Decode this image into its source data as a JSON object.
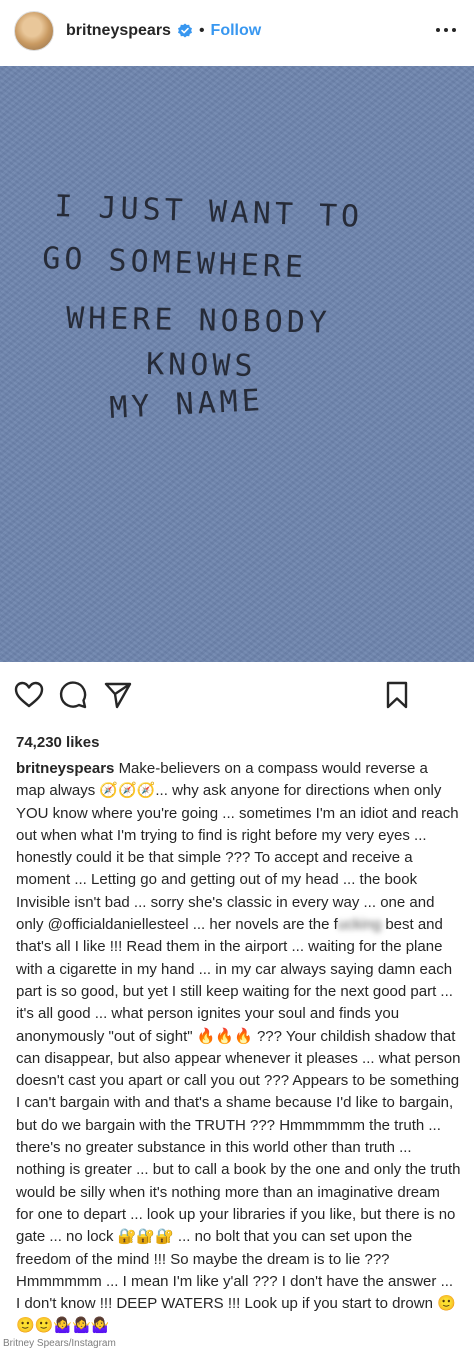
{
  "header": {
    "username": "britneyspears",
    "separator": "•",
    "follow_label": "Follow"
  },
  "photo": {
    "handwritten_lines": [
      "I JUST WANT TO",
      "GO SOMEWHERE",
      "WHERE NOBODY",
      "KNOWS",
      "MY NAME"
    ]
  },
  "likes": "74,230 likes",
  "caption": {
    "username": "britneyspears",
    "part1": "Make-believers on a compass would reverse a map always 🧭🧭🧭... why ask anyone for directions when only YOU know where you're going ... sometimes I'm an idiot and reach out when what I'm trying to find is right before my very eyes ... honestly could it be that simple ??? To accept and receive a moment ... Letting go and getting out of my head ... the book Invisible isn't bad ... sorry she's classic in every way ... one and only @officialdaniellesteel ... her novels are the f",
    "blurred": "ucking",
    "part2": " best and that's all I like !!! Read them in the airport ... waiting for the plane with a cigarette in my hand ... in my car always saying damn each part is so good, but yet I still keep waiting for the next good part ... it's all good ... what person ignites your soul and finds you anonymously \"out of sight\" 🔥🔥🔥 ??? Your childish shadow that can disappear, but also appear whenever it pleases ... what person doesn't cast you apart or call you out ??? Appears to be something I can't bargain with and that's a shame because I'd like to bargain, but do we bargain with the TRUTH ??? Hmmmmmm the truth ... there's no greater substance in this world other than truth ... nothing is greater ... but to call a book by the one and only the truth would be silly when it's nothing more than an imaginative dream for one to depart ... look up your libraries if you like, but there is no gate ... no lock 🔐🔐🔐 ... no bolt that you can set upon the freedom of the mind !!! So maybe the dream is to lie ??? Hmmmmmm ... I mean I'm like y'all ??? I don't have the answer ... I don't know !!! DEEP WATERS !!! Look up if you start to drown 🙂🙂🙂🤷‍♀️🤷‍♀️🤷‍♀️"
  },
  "credit": "Britney Spears/Instagram",
  "colors": {
    "accent": "#3897f0",
    "photo_bg": "#6e85ae",
    "ink": "#262b38"
  },
  "icons": [
    "avatar",
    "verified-badge-icon",
    "more-options-icon",
    "heart-icon",
    "comment-icon",
    "share-icon",
    "bookmark-icon"
  ]
}
